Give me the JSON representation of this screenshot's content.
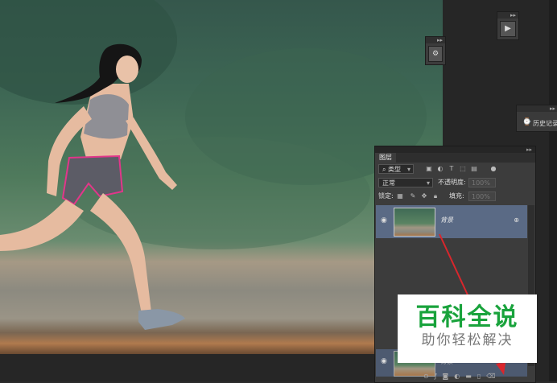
{
  "layers_panel": {
    "tab_label": "图层",
    "collapse_glyph": "▸▸",
    "filter_kind_label": "类型",
    "blend_mode": "正常",
    "opacity_label": "不透明度:",
    "opacity_value": "100%",
    "lock_label": "锁定:",
    "fill_label": "填充:",
    "fill_value": "100%",
    "layers": [
      {
        "name": "背景",
        "visible": true,
        "locked": true
      }
    ]
  },
  "history_panel": {
    "label": "历史记录"
  },
  "watermark": {
    "title": "百科全说",
    "subtitle": "助你轻松解决",
    "title_color": "#19a33c"
  },
  "annotation": {
    "arrow_color": "#d9262c"
  },
  "icons": [
    "eye-icon",
    "lock-icon",
    "search-icon",
    "play-icon",
    "history-icon",
    "new-layer-icon"
  ]
}
